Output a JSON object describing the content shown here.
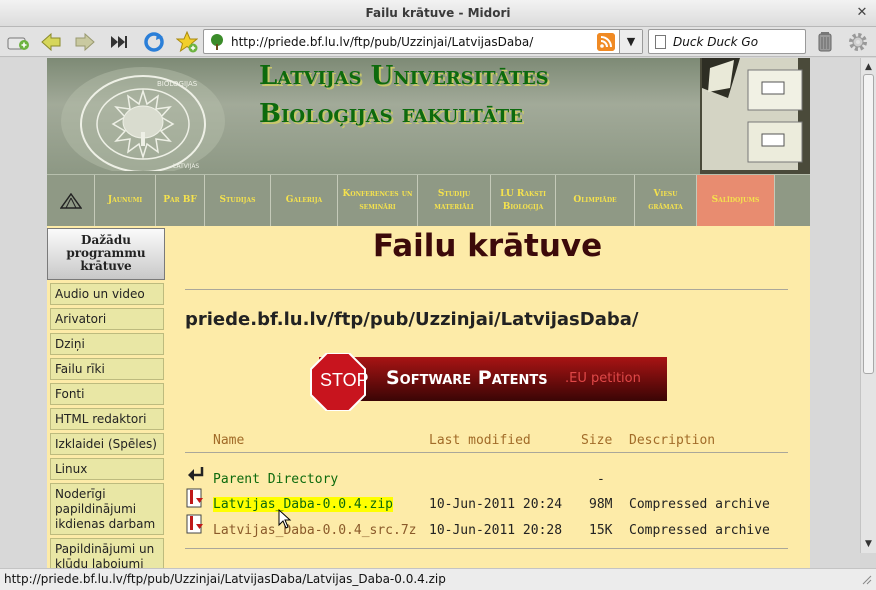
{
  "window": {
    "title": "Failu krātuve - Midori"
  },
  "toolbar": {
    "url": "http://priede.bf.lu.lv/ftp/pub/Uzzinjai/LatvijasDaba/",
    "search_placeholder": "Duck Duck Go"
  },
  "header": {
    "line1": "Latvijas Universitātes",
    "line2": "Bioloģijas fakultāte",
    "logo_text": "BIOLOĢIJAS FAKULTĀTE · LATVIJAS UNIVERSITĀTE"
  },
  "nav": {
    "items": [
      {
        "label": "Jaunumi"
      },
      {
        "label": "Par BF"
      },
      {
        "label": "Studijas"
      },
      {
        "label": "Galerija"
      },
      {
        "label": "Konferences un semināri"
      },
      {
        "label": "Studiju materiāli"
      },
      {
        "label": "LU Raksti Bioloģija"
      },
      {
        "label": "Olimpiāde"
      },
      {
        "label": "Viesu grāmata"
      },
      {
        "label": "Salīdojums"
      }
    ]
  },
  "sidebar": {
    "heading": "Dažādu programmu krātuve",
    "items": [
      {
        "label": "Audio un video"
      },
      {
        "label": "Arivatori"
      },
      {
        "label": "Dziņi"
      },
      {
        "label": "Failu rīki"
      },
      {
        "label": "Fonti"
      },
      {
        "label": "HTML redaktori"
      },
      {
        "label": "Izklaidei (Spēles)"
      },
      {
        "label": "Linux"
      },
      {
        "label": "Noderīgi papildinājumi ikdienas darbam"
      },
      {
        "label": "Papildinājumi un kļūdu labojumi"
      }
    ]
  },
  "main": {
    "title": "Failu krātuve",
    "path": "priede.bf.lu.lv/ftp/pub/Uzzinjai/LatvijasDaba/",
    "banner": {
      "stop": "STOP",
      "text": "Software Patents",
      "sub": ".EU petition"
    },
    "listing": {
      "headers": {
        "name": "Name",
        "modified": "Last modified",
        "size": "Size",
        "description": "Description"
      },
      "parent": {
        "name": "Parent Directory",
        "size": "-"
      },
      "rows": [
        {
          "name": "Latvijas_Daba-0.0.4.zip",
          "modified": "10-Jun-2011 20:24",
          "size": "98M",
          "description": "Compressed archive"
        },
        {
          "name": "Latvijas_Daba-0.0.4_src.7z",
          "modified": "10-Jun-2011 20:28",
          "size": "15K",
          "description": "Compressed archive"
        }
      ]
    }
  },
  "statusbar": {
    "text": "http://priede.bf.lu.lv/ftp/pub/Uzzinjai/LatvijasDaba/Latvijas_Daba-0.0.4.zip"
  },
  "colors": {
    "nav_active": "#e88c70",
    "link": "#0d6a0d",
    "visited": "#8a5a2a",
    "highlight": "#ffff00"
  }
}
